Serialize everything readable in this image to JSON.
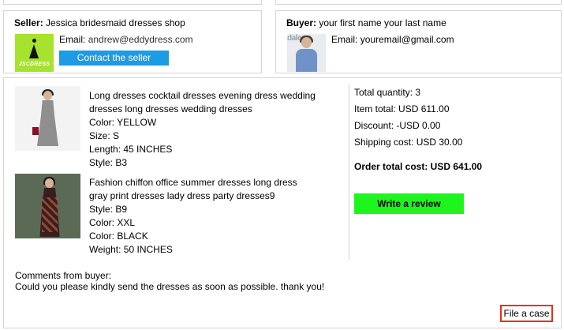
{
  "seller": {
    "label": "Seller:",
    "name": "Jessica bridesmaid dresses shop",
    "logo_text": "JSCDRESS",
    "email_label": "Email:",
    "email": "andrew@eddydress.com",
    "contact_button": "Contact the seller"
  },
  "buyer": {
    "label": "Buyer:",
    "name": "your first name your last name",
    "avatar_text": "dale",
    "email_label": "Email:",
    "email": "youremail@gmail.com"
  },
  "items": [
    {
      "title": "Long dresses cocktail dresses evening dress wedding dresses long dresses wedding dresses",
      "lines": [
        "Color: YELLOW",
        "Size: S",
        "Length: 45 INCHES",
        "Style: B3"
      ]
    },
    {
      "title": "Fashion chiffon office summer dresses long dress gray print dresses lady dress party dresses9",
      "lines": [
        "Style: B9",
        "Color: XXL",
        "Color: BLACK",
        "Weight: 50 INCHES"
      ]
    }
  ],
  "summary": {
    "total_quantity": "Total quantity: 3",
    "item_total": "Item total: USD 611.00",
    "discount": "Discount: -USD 0.00",
    "shipping": "Shipping cost: USD 30.00",
    "order_total": "Order total cost: USD 641.00",
    "review_button": "Write a review"
  },
  "comments": {
    "label": "Comments from buyer:",
    "text": "Could you please kindly send the dresses as soon as possible. thank you!"
  },
  "file_case_button": "File a case",
  "colors": {
    "contact_button": "#1e9be3",
    "review_button": "#1ef41e",
    "file_case_border": "#e8310f",
    "logo_bg": "#a6e22e"
  }
}
